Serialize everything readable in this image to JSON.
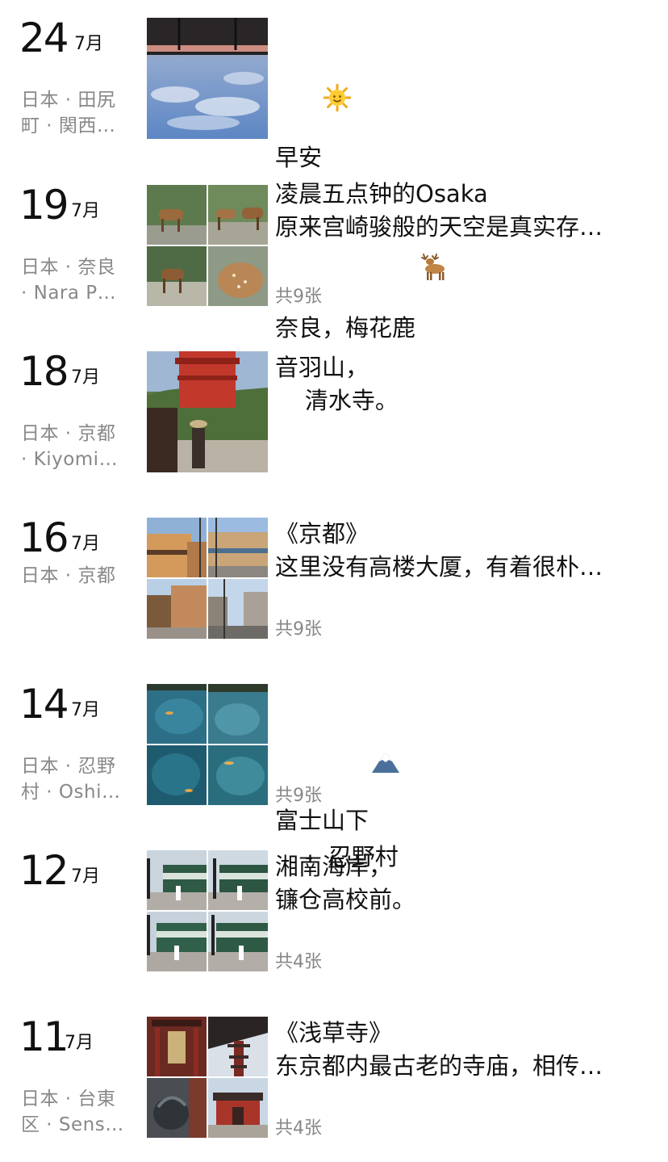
{
  "entries": [
    {
      "day": "24",
      "month": "7月",
      "location": [
        "日本 · 田尻",
        "町 · 関西…"
      ],
      "lines": [
        "早安",
        "凌晨五点钟的Osaka",
        "原来宫崎骏般的天空是真实存…"
      ],
      "emoji": "sun-icon",
      "count": ""
    },
    {
      "day": "19",
      "month": "7月",
      "location": [
        "日本 · 奈良",
        "· Nara P…"
      ],
      "lines": [
        "奈良，梅花鹿"
      ],
      "emoji": "deer-icon",
      "count": "共9张"
    },
    {
      "day": "18",
      "month": "7月",
      "location": [
        "日本 · 京都",
        "· Kiyomi…"
      ],
      "lines": [
        "音羽山，",
        "    清水寺。"
      ],
      "emoji": "",
      "count": ""
    },
    {
      "day": "16",
      "month": "7月",
      "location": [
        "日本 · 京都"
      ],
      "lines": [
        "《京都》",
        "这里没有高楼大厦，有着很朴…"
      ],
      "emoji": "",
      "count": "共9张"
    },
    {
      "day": "14",
      "month": "7月",
      "location": [
        "日本 · 忍野",
        "村 · Oshi…"
      ],
      "lines": [
        "富士山下",
        "    -  忍野村"
      ],
      "emoji": "mountain-icon",
      "count": "共9张"
    },
    {
      "day": "12",
      "month": "7月",
      "location": [],
      "lines": [
        "湘南海岸，",
        "镰仓高校前。"
      ],
      "emoji": "",
      "count": "共4张"
    },
    {
      "day": "11",
      "month": "7月",
      "location": [
        "日本 · 台東",
        "区 · Sens…"
      ],
      "lines": [
        "《浅草寺》",
        "东京都内最古老的寺庙，相传…"
      ],
      "emoji": "",
      "count": "共4张"
    }
  ]
}
